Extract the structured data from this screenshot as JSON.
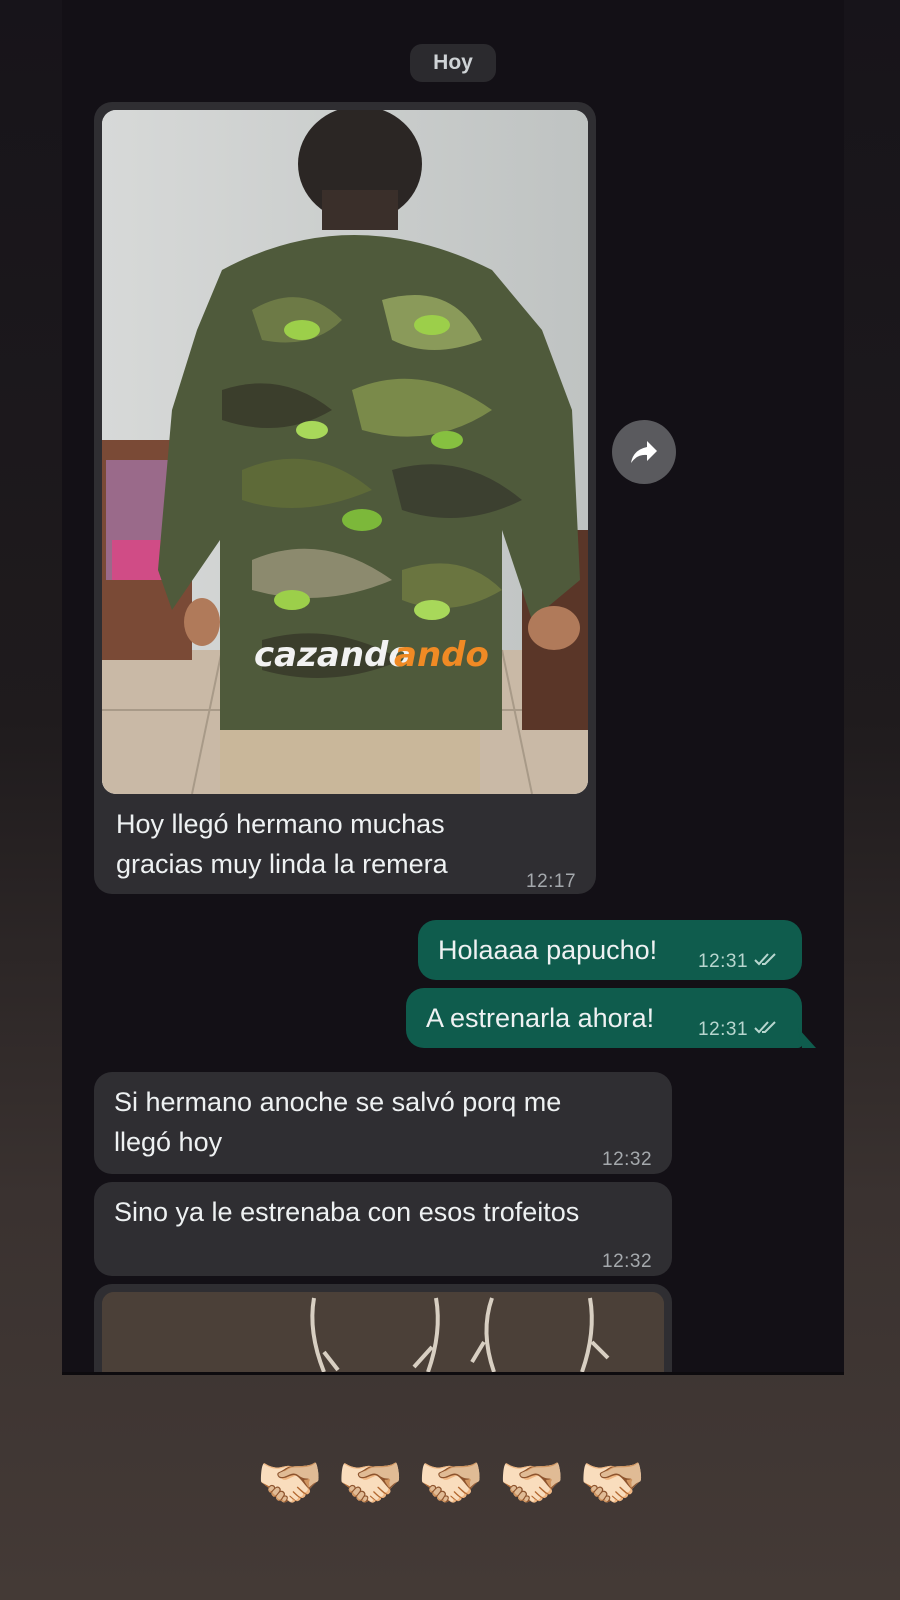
{
  "date_divider": "Hoy",
  "messages": [
    {
      "id": "m1",
      "direction": "incoming",
      "has_image": true,
      "text": "Hoy llegó hermano muchas gracias muy linda la remera",
      "line1": "Hoy llegó hermano muchas",
      "line2": "gracias muy linda la remera",
      "time": "12:17"
    },
    {
      "id": "m2",
      "direction": "outgoing",
      "text": "Holaaaa papucho!",
      "time": "12:31",
      "status": "read"
    },
    {
      "id": "m3",
      "direction": "outgoing",
      "text": "A estrenarla ahora!",
      "time": "12:31",
      "status": "read"
    },
    {
      "id": "m4",
      "direction": "incoming",
      "line1": "Si hermano anoche se salvó porq me",
      "line2": "llegó hoy",
      "time": "12:32"
    },
    {
      "id": "m5",
      "direction": "incoming",
      "text": "Sino ya le estrenaba con esos trofeitos",
      "time": "12:32"
    },
    {
      "id": "m6",
      "direction": "incoming",
      "has_image": true,
      "partially_visible": true
    }
  ],
  "photo_print": {
    "part1": "cazando",
    "part2": "ando"
  },
  "forward_button_icon": "forward-arrow-icon",
  "reactions": [
    "🫱🏻‍🫲🏼",
    "🫱🏻‍🫲🏼",
    "🫱🏻‍🫲🏼",
    "🫱🏻‍🫲🏼",
    "🫱🏻‍🫲🏼"
  ],
  "colors": {
    "incoming_bubble": "#2f2e32",
    "outgoing_bubble": "#0f5c4d",
    "chat_bg": "#131016"
  }
}
